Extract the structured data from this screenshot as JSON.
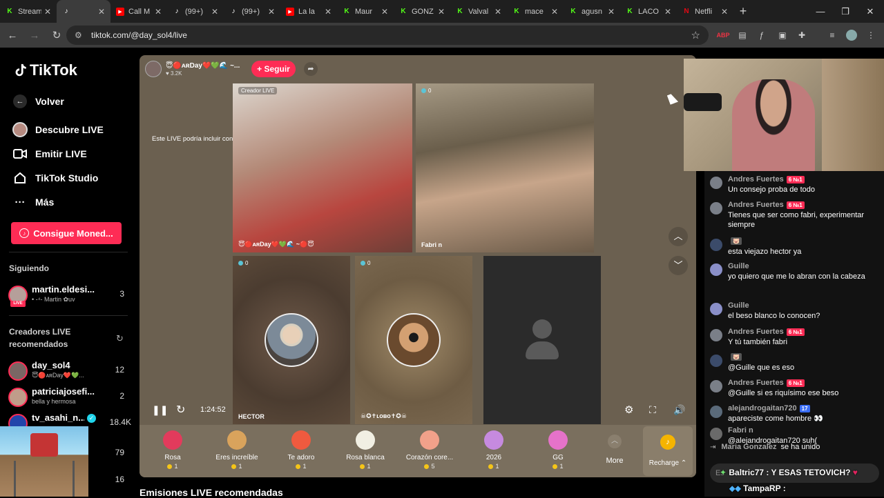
{
  "browser": {
    "tabs": [
      {
        "title": "Stream",
        "icon": "kick-icon",
        "color": "#53fc18"
      },
      {
        "title": "",
        "icon": "tiktok-icon",
        "color": "#ffffff",
        "active": true
      },
      {
        "title": "Call M",
        "icon": "youtube-icon",
        "color": "#ff0000"
      },
      {
        "title": "(99+)",
        "icon": "tiktok-icon",
        "color": "#ffffff"
      },
      {
        "title": "(99+)",
        "icon": "tiktok-icon",
        "color": "#ffffff"
      },
      {
        "title": "La la",
        "icon": "youtube-icon",
        "color": "#ff0000"
      },
      {
        "title": "Maur",
        "icon": "kick-icon",
        "color": "#53fc18"
      },
      {
        "title": "GONZ",
        "icon": "kick-icon",
        "color": "#53fc18"
      },
      {
        "title": "Valval",
        "icon": "kick-icon",
        "color": "#53fc18"
      },
      {
        "title": "mace",
        "icon": "kick-icon",
        "color": "#53fc18"
      },
      {
        "title": "agusn",
        "icon": "kick-icon",
        "color": "#53fc18"
      },
      {
        "title": "LACO",
        "icon": "kick-icon",
        "color": "#53fc18"
      },
      {
        "title": "Netfli",
        "icon": "netflix-icon",
        "color": "#e50914"
      }
    ],
    "url": "tiktok.com/@day_sol4/live"
  },
  "sidebar": {
    "logo": "TikTok",
    "nav": [
      {
        "label": "Volver",
        "icon": "back-arrow-icon"
      },
      {
        "label": "Descubre LIVE",
        "icon": "live-avatar-icon"
      },
      {
        "label": "Emitir LIVE",
        "icon": "camera-icon"
      },
      {
        "label": "TikTok Studio",
        "icon": "home-icon"
      },
      {
        "label": "Más",
        "icon": "more-dots-icon"
      }
    ],
    "coins_button": "Consigue Moned...",
    "following_title": "Siguiendo",
    "following": [
      {
        "name": "martin.eldesi...",
        "sub": "• -⁴- Martin ✿uv",
        "count": "3"
      }
    ],
    "recommended_title": "Creadores LIVE recomendados",
    "recommended": [
      {
        "name": "day_sol4",
        "sub": "😇🔴ᴀʀDay❤️💚...",
        "count": "12"
      },
      {
        "name": "patriciajosefi...",
        "sub": "bella y hermosa",
        "count": "2"
      },
      {
        "name": "tv_asahi_n...",
        "sub": "",
        "count": "18.4K",
        "verified": true
      },
      {
        "name": "",
        "sub": "",
        "count": "79"
      },
      {
        "name": "",
        "sub": "",
        "count": "16"
      }
    ]
  },
  "live": {
    "host_name": "😇🔴ᴀʀDay❤️💚🌊 ~...",
    "host_likes": "♥ 3.2K",
    "follow_label": "+ Seguir",
    "ai_notice": "Este LIVE podría incluir contenido generado por IA",
    "creator_tag": "Creador LIVE",
    "cells": [
      {
        "label": "😇🔴ᴀʀDay❤️💚🌊 ~🔴😇",
        "score": ""
      },
      {
        "label": "Fabri n",
        "score": "0"
      },
      {
        "label": "HECTOR",
        "score": "0"
      },
      {
        "label": "☠✪✝ʟᴏʙᴏ✝✪☠",
        "score": "0"
      },
      {
        "label": "",
        "score": ""
      }
    ],
    "time": "1:24:52"
  },
  "gifts": [
    {
      "name": "Rosa",
      "price": "1",
      "color": "#e23b5c"
    },
    {
      "name": "Eres increíble",
      "price": "1",
      "color": "#d9a35c"
    },
    {
      "name": "Te adoro",
      "price": "1",
      "color": "#ef5a3f"
    },
    {
      "name": "Rosa blanca",
      "price": "1",
      "color": "#f1efe3"
    },
    {
      "name": "Corazón core...",
      "price": "5",
      "color": "#f1a18a"
    },
    {
      "name": "2026",
      "price": "1",
      "color": "#c68adf"
    },
    {
      "name": "GG",
      "price": "1",
      "color": "#e572c9"
    }
  ],
  "more_label": "More",
  "recharge_label": "Recharge ⌃",
  "recommended_heading": "Emisiones LIVE recomendadas",
  "chat": [
    {
      "name": "Andres Fuertes",
      "badge": "6 №1",
      "text": "Un consejo proba de todo"
    },
    {
      "name": "Andres Fuertes",
      "badge": "6 №1",
      "text": "Tienes que ser como fabri, experimentar siempre"
    },
    {
      "name": "",
      "badge": "🐷",
      "text": "esta viejazo hector ya"
    },
    {
      "name": "Guille",
      "badge": "",
      "text": "yo quiero que me lo abran con la cabeza"
    },
    {
      "name": "Guille",
      "badge": "",
      "text": "el beso blanco lo conocen?"
    },
    {
      "name": "Andres Fuertes",
      "badge": "6 №1",
      "text": "Y tú también fabri"
    },
    {
      "name": "",
      "badge": "🐷",
      "text": "@Guille que es eso"
    },
    {
      "name": "Andres Fuertes",
      "badge": "6 №1",
      "text": "@Guille si es riquísimo ese beso"
    },
    {
      "name": "alejandrogaitan720",
      "badge": "17",
      "text": "apareciste come hombre 👀"
    },
    {
      "name": "Fabri n",
      "badge": "",
      "text": "@alejandrogaitan720 suh("
    }
  ],
  "join": {
    "name": "Maria Gonzalez",
    "text": "se ha unido"
  },
  "chat_placeholder": "Es",
  "overlay_msgs": [
    "Baltric77 : Y ESAS TETOVICH?",
    "TampaRP :"
  ]
}
